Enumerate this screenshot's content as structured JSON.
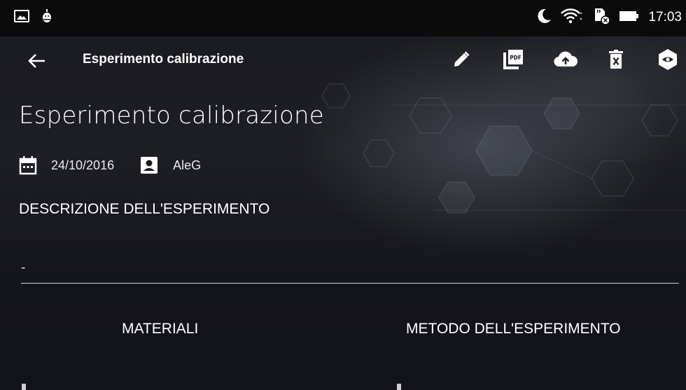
{
  "status_bar": {
    "time": "17:03",
    "left_icons": [
      "gallery-icon",
      "android-debug-icon"
    ],
    "right_icons": [
      "moon-icon",
      "wifi-icon",
      "sd-card-icon",
      "battery-icon"
    ]
  },
  "toolbar": {
    "title": "Esperimento calibrazione",
    "actions": [
      "edit-icon",
      "pdf-icon",
      "cloud-upload-icon",
      "delete-icon",
      "visibility-icon"
    ]
  },
  "experiment": {
    "title": "Esperimento calibrazione",
    "date": "24/10/2016",
    "author": "AleG",
    "description_heading": "DESCRIZIONE DELL'ESPERIMENTO",
    "description_value": "-",
    "materials_heading": "MATERIALI",
    "method_heading": "METODO DELL'ESPERIMENTO"
  },
  "colors": {
    "status_bar_bg": "#0b0b0c",
    "background": "#1a1b1f",
    "text": "#ffffff",
    "divider": "#cfcfcf"
  }
}
